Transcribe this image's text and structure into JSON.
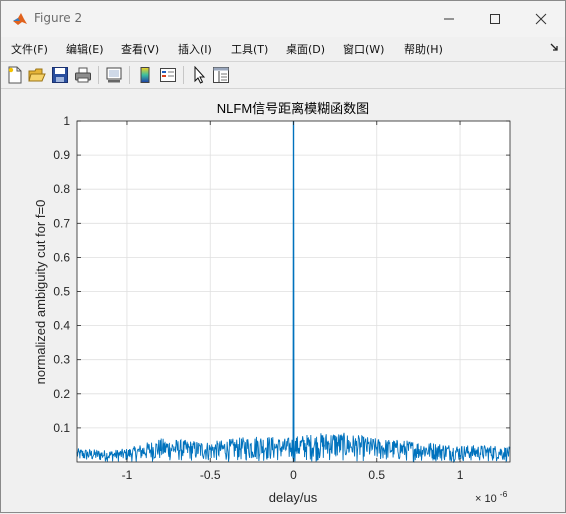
{
  "window": {
    "title": "Figure 2"
  },
  "menu": [
    "文件(F)",
    "编辑(E)",
    "查看(V)",
    "插入(I)",
    "工具(T)",
    "桌面(D)",
    "窗口(W)",
    "帮助(H)"
  ],
  "toolbar": {
    "icons": [
      "new-figure-icon",
      "open-file-icon",
      "save-icon",
      "print-icon",
      "link-plot-icon",
      "insert-colorbar-icon",
      "insert-legend-icon",
      "edit-plot-arrow-icon",
      "property-inspector-icon"
    ]
  },
  "colors": {
    "line": "#0072bd",
    "grid": "#dfdfdf",
    "axes": "#262626"
  },
  "chart_data": {
    "type": "line",
    "title": "NLFM信号距离模糊函数图",
    "xlabel": "delay/us",
    "ylabel": "normalized ambiguity cut for f=0",
    "x_exponent": "× 10^-6",
    "x_exponent_base": "× 10",
    "x_exponent_power": "-6",
    "xlim": [
      -1.3e-06,
      1.3e-06
    ],
    "ylim": [
      0,
      1
    ],
    "xticks": [
      -1e-06,
      -5e-07,
      0,
      5e-07,
      1e-06
    ],
    "xtick_labels": [
      "-1",
      "-0.5",
      "0",
      "0.5",
      "1"
    ],
    "yticks": [
      0.1,
      0.2,
      0.3,
      0.4,
      0.5,
      0.6,
      0.7,
      0.8,
      0.9,
      1
    ],
    "ytick_labels": [
      "0.1",
      "0.2",
      "0.3",
      "0.4",
      "0.5",
      "0.6",
      "0.7",
      "0.8",
      "0.9",
      "1"
    ],
    "grid": true,
    "series": [
      {
        "peak": {
          "x": 0,
          "y": 1.0
        },
        "sidelobe_envelope": [
          [
            -1.3e-06,
            0.04
          ],
          [
            -1.1e-06,
            0.035
          ],
          [
            -1e-06,
            0.04
          ],
          [
            -8e-07,
            0.07
          ],
          [
            -5e-07,
            0.06
          ],
          [
            -2e-07,
            0.08
          ],
          [
            -5e-08,
            0.07
          ],
          [
            5e-08,
            0.08
          ],
          [
            2.5e-07,
            0.09
          ],
          [
            5e-07,
            0.07
          ],
          [
            8e-07,
            0.06
          ],
          [
            1e-06,
            0.05
          ],
          [
            1.2e-06,
            0.05
          ],
          [
            1.3e-06,
            0.045
          ]
        ]
      }
    ]
  }
}
